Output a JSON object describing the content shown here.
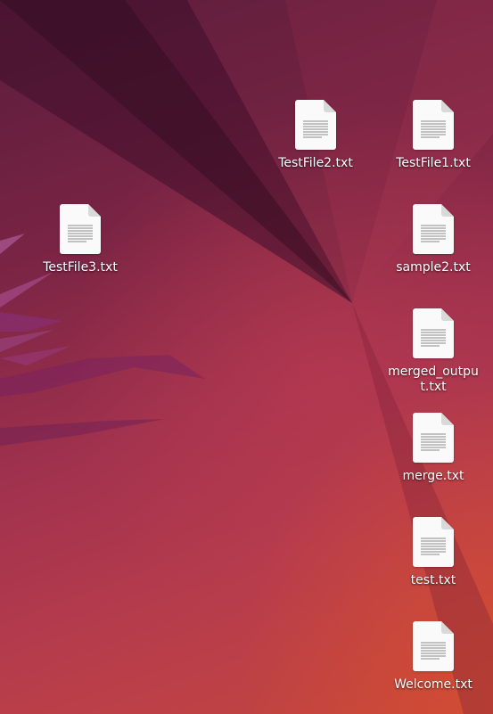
{
  "desktop": {
    "icons": [
      {
        "name": "TestFile2.txt",
        "type": "text-file-icon"
      },
      {
        "name": "TestFile1.txt",
        "type": "text-file-icon"
      },
      {
        "name": "TestFile3.txt",
        "type": "text-file-icon"
      },
      {
        "name": "sample2.txt",
        "type": "text-file-icon"
      },
      {
        "name": "merged_output.txt",
        "type": "text-file-icon"
      },
      {
        "name": "merge.txt",
        "type": "text-file-icon"
      },
      {
        "name": "test.txt",
        "type": "text-file-icon"
      },
      {
        "name": "Welcome.txt",
        "type": "text-file-icon"
      }
    ]
  }
}
